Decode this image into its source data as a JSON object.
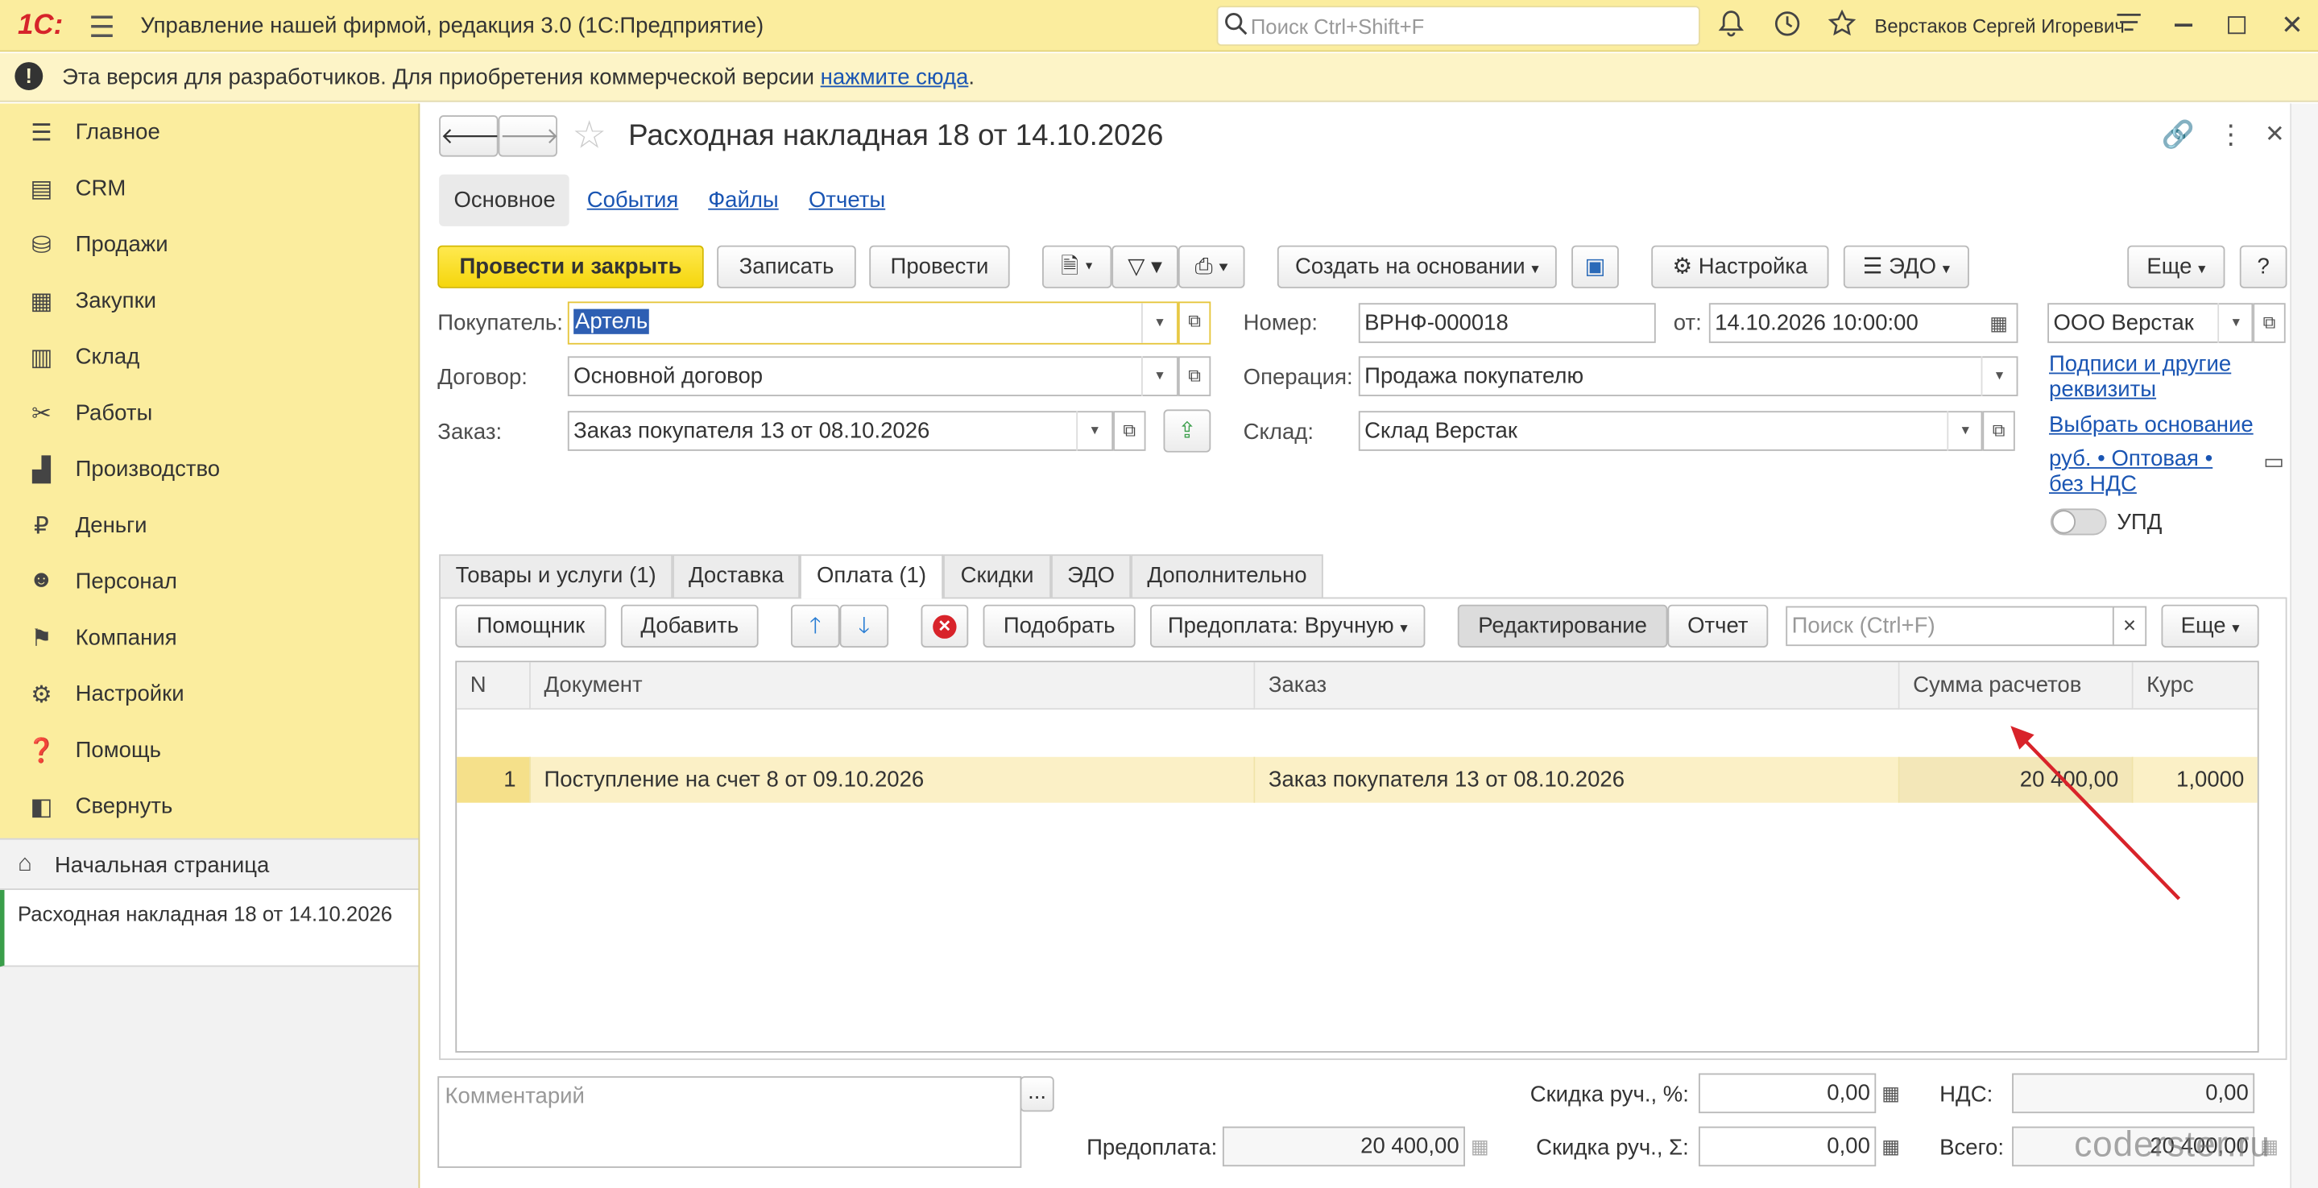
{
  "titlebar": {
    "logo": "1С:",
    "title": "Управление нашей фирмой, редакция 3.0  (1С:Предприятие)",
    "search_placeholder": "Поиск Ctrl+Shift+F",
    "user": "Верстаков Сергей Игоревич"
  },
  "banner": {
    "text": "Эта версия для разработчиков. Для приобретения коммерческой версии ",
    "link": "нажмите сюда",
    "tail": "."
  },
  "sidebar": {
    "items": [
      {
        "label": "Главное",
        "icon": "menu-lines-icon"
      },
      {
        "label": "CRM",
        "icon": "contact-card-icon"
      },
      {
        "label": "Продажи",
        "icon": "basket-icon"
      },
      {
        "label": "Закупки",
        "icon": "cart-icon"
      },
      {
        "label": "Склад",
        "icon": "warehouse-icon"
      },
      {
        "label": "Работы",
        "icon": "tools-icon"
      },
      {
        "label": "Производство",
        "icon": "factory-icon"
      },
      {
        "label": "Деньги",
        "icon": "ruble-icon"
      },
      {
        "label": "Персонал",
        "icon": "people-icon"
      },
      {
        "label": "Компания",
        "icon": "flag-icon"
      },
      {
        "label": "Настройки",
        "icon": "gear-icon"
      },
      {
        "label": "Помощь",
        "icon": "help-icon"
      },
      {
        "label": "Свернуть",
        "icon": "collapse-icon"
      }
    ],
    "home": "Начальная страница",
    "open_doc": "Расходная накладная 18 от 14.10.2026"
  },
  "doc": {
    "title": "Расходная накладная 18 от 14.10.2026",
    "section_tabs": [
      "Основное",
      "События",
      "Файлы",
      "Отчеты"
    ],
    "toolbar": {
      "post_close": "Провести и закрыть",
      "save": "Записать",
      "post": "Провести",
      "create_based": "Создать на основании",
      "settings": "Настройка",
      "edo": "ЭДО",
      "more": "Еще",
      "help": "?"
    },
    "fields": {
      "buyer_label": "Покупатель:",
      "buyer": "Артель",
      "contract_label": "Договор:",
      "contract": "Основной договор",
      "order_label": "Заказ:",
      "order": "Заказ покупателя 13 от 08.10.2026",
      "number_label": "Номер:",
      "number": "ВРНФ-000018",
      "from_label": "от:",
      "date": "14.10.2026 10:00:00",
      "operation_label": "Операция:",
      "operation": "Продажа покупателю",
      "warehouse_label": "Склад:",
      "warehouse": "Склад Верстак",
      "company": "ООО Верстак",
      "signatures_link": "Подписи и другие реквизиты",
      "choose_basis_link": "Выбрать основание",
      "price_link": "руб. • Оптовая • без НДС",
      "upd_label": "УПД"
    },
    "tabs": [
      "Товары и услуги (1)",
      "Доставка",
      "Оплата (1)",
      "Скидки",
      "ЭДО",
      "Дополнительно"
    ],
    "table_toolbar": {
      "helper": "Помощник",
      "add": "Добавить",
      "pick": "Подобрать",
      "prepay": "Предоплата: Вручную",
      "edit": "Редактирование",
      "report": "Отчет",
      "search_placeholder": "Поиск (Ctrl+F)",
      "clear": "×",
      "more": "Еще"
    },
    "table": {
      "columns": [
        "N",
        "Документ",
        "Заказ",
        "Сумма расчетов",
        "Курс"
      ],
      "rows": [
        [
          "1",
          "Поступление на счет 8 от 09.10.2026",
          "Заказ покупателя 13 от 08.10.2026",
          "20 400,00",
          "1,0000"
        ]
      ]
    },
    "footer": {
      "comment_placeholder": "Комментарий",
      "comment_btn": "...",
      "prepay_label": "Предоплата:",
      "prepay": "20 400,00",
      "disc_pct_label": "Скидка руч., %:",
      "disc_pct": "0,00",
      "disc_sum_label": "Скидка руч., Σ:",
      "disc_sum": "0,00",
      "vat_label": "НДС:",
      "vat": "0,00",
      "total_label": "Всего:",
      "total": "20 400,00"
    },
    "watermark": "coderster.ru"
  }
}
